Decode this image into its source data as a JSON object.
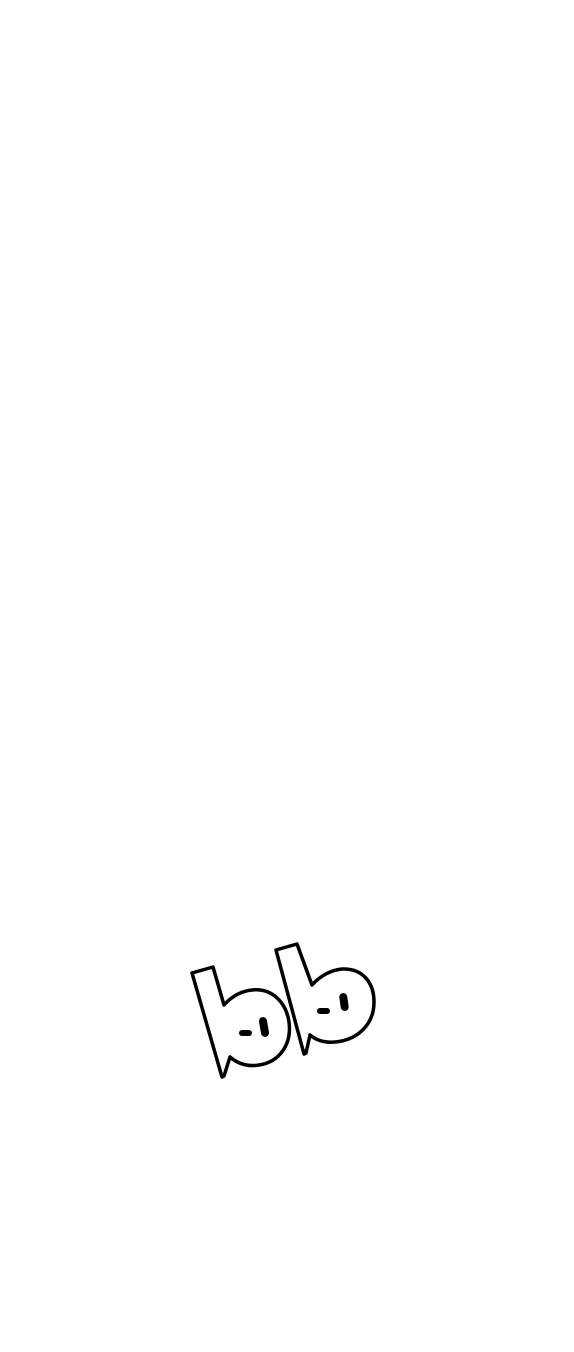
{
  "page": {
    "background_color": "#ffffff"
  },
  "logo": {
    "text": "bb",
    "icon": "bb-outline-logo-icon",
    "fill_color": "#ffffff",
    "stroke_color": "#000000"
  }
}
